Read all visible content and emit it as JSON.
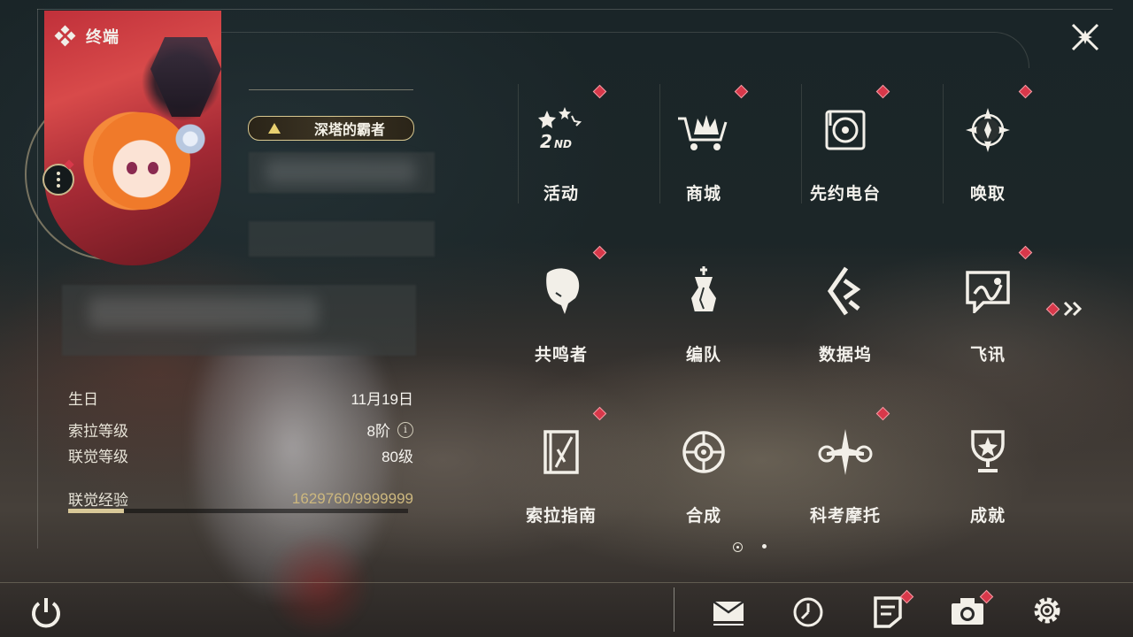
{
  "header": {
    "title": "终端"
  },
  "profile": {
    "title_badge": "深塔的霸者"
  },
  "stats": {
    "birthday_label": "生日",
    "birthday_value": "11月19日",
    "sola_level_label": "索拉等级",
    "sola_level_value": "8阶",
    "union_level_label": "联觉等级",
    "union_level_value": "80级",
    "union_exp_label": "联觉经验",
    "union_exp_value": "1629760/9999999",
    "union_exp_progress": 0.163
  },
  "menu": {
    "items": [
      {
        "label": "活动",
        "icon": "events-icon",
        "alert": true
      },
      {
        "label": "商城",
        "icon": "shop-icon",
        "alert": true
      },
      {
        "label": "先约电台",
        "icon": "radio-icon",
        "alert": true
      },
      {
        "label": "唤取",
        "icon": "convene-icon",
        "alert": true
      },
      {
        "label": "共鸣者",
        "icon": "resonator-icon",
        "alert": true
      },
      {
        "label": "编队",
        "icon": "team-icon",
        "alert": false
      },
      {
        "label": "数据坞",
        "icon": "data-bank-icon",
        "alert": false
      },
      {
        "label": "飞讯",
        "icon": "message-icon",
        "alert": true
      },
      {
        "label": "索拉指南",
        "icon": "guidebook-icon",
        "alert": true
      },
      {
        "label": "合成",
        "icon": "synthesis-icon",
        "alert": false
      },
      {
        "label": "科考摩托",
        "icon": "motorcycle-icon",
        "alert": true
      },
      {
        "label": "成就",
        "icon": "achievement-icon",
        "alert": false
      }
    ],
    "page": 1,
    "page_count": 2
  },
  "bottom_bar": {
    "icons": [
      "power-icon",
      "mail-icon",
      "clock-icon",
      "notice-icon",
      "camera-icon",
      "settings-icon"
    ]
  },
  "colors": {
    "alert": "#d8384a",
    "accent_gold": "#d8c898"
  }
}
